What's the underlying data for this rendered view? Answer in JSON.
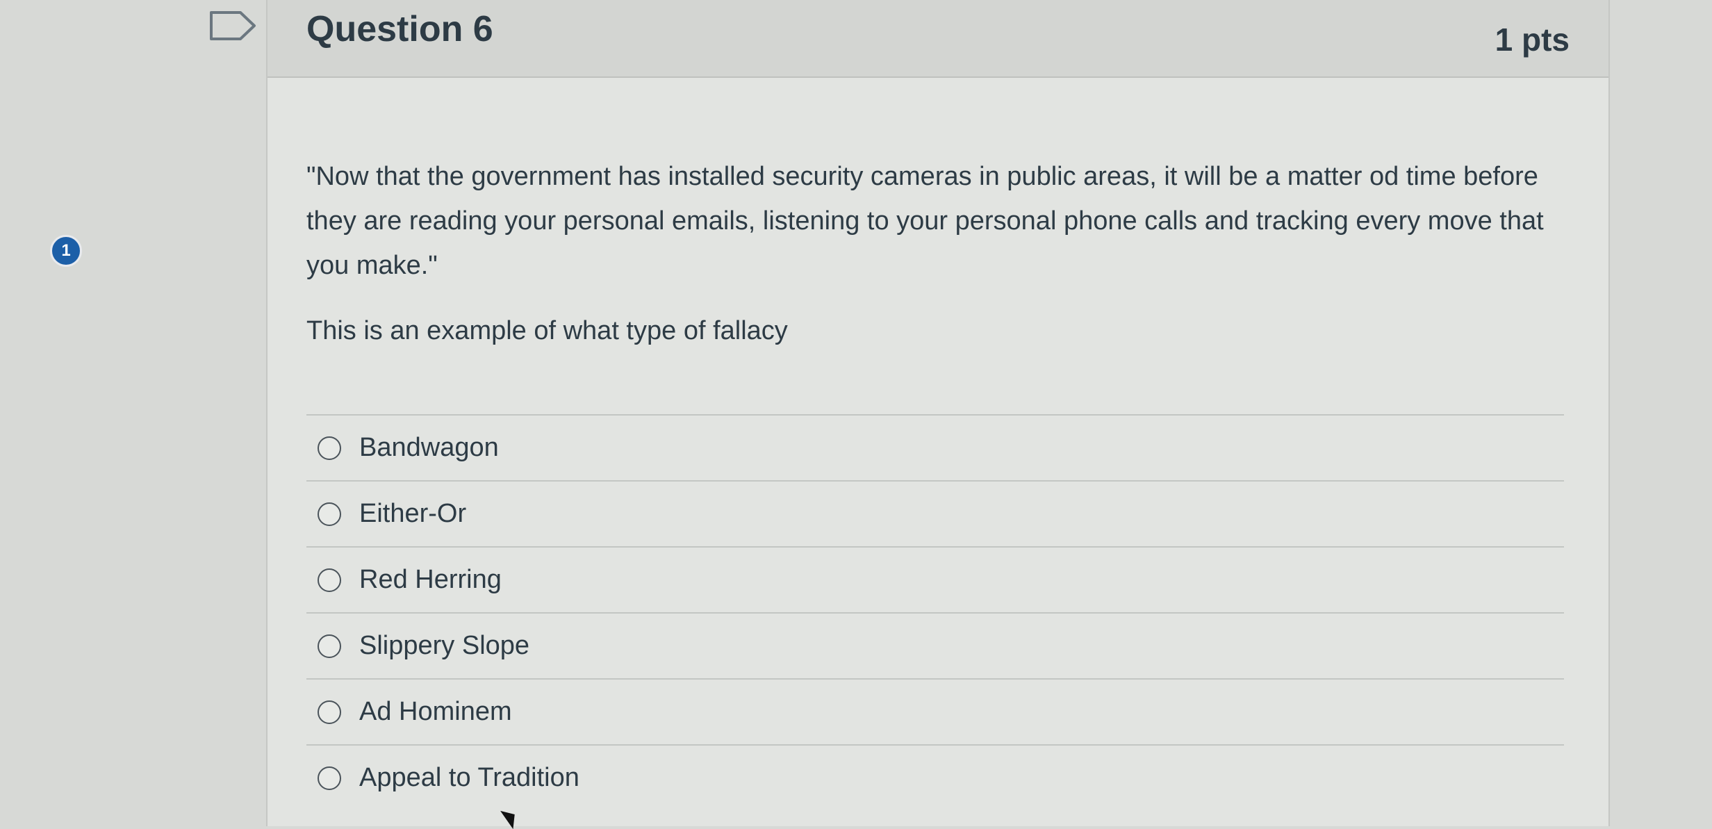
{
  "question": {
    "title": "Question 6",
    "points": "1 pts",
    "text": "\"Now that the government has installed security cameras in public areas, it will be a matter od time before they are reading your personal emails, listening to your personal phone calls and tracking every move that you make.\"",
    "prompt": "This is an example of what type of fallacy"
  },
  "badge": {
    "count": "1",
    "color": "#1c5fa8"
  },
  "answers": [
    {
      "label": "Bandwagon"
    },
    {
      "label": "Either-Or"
    },
    {
      "label": "Red Herring"
    },
    {
      "label": "Slippery Slope"
    },
    {
      "label": "Ad Hominem"
    },
    {
      "label": "Appeal to Tradition"
    }
  ],
  "icons": {
    "flag": "flag-bookmark-icon",
    "cursor": "mouse-cursor-icon"
  }
}
